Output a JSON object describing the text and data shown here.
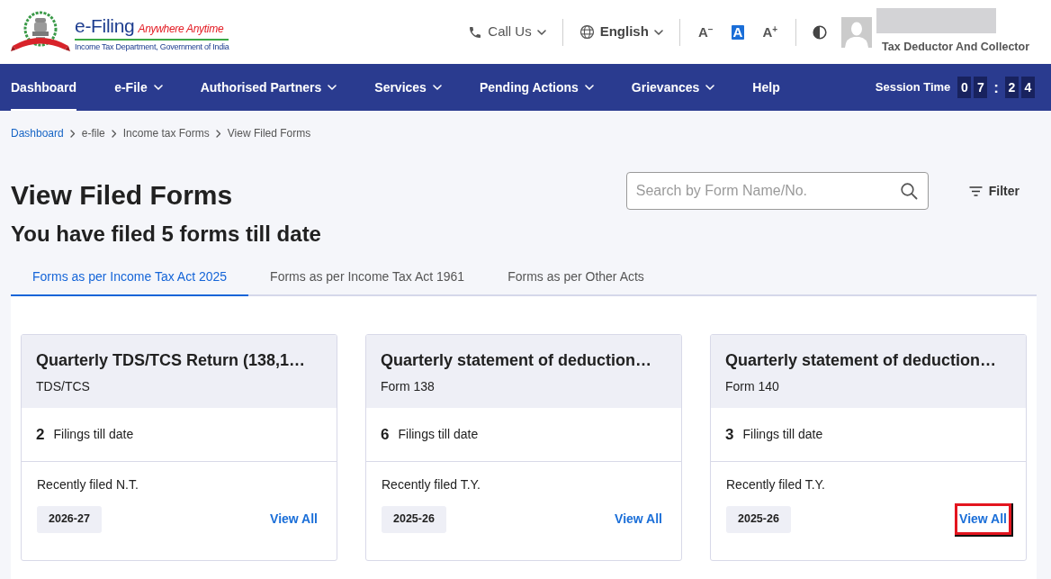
{
  "header": {
    "logo": {
      "brand": "e-Filing",
      "tagline": "Anywhere Anytime",
      "department": "Income Tax Department, Government of India"
    },
    "call_us": {
      "label": "Call Us"
    },
    "language": {
      "label": "English"
    },
    "text_size": [
      {
        "label": "A$^{−}$",
        "selected": false
      },
      {
        "label": "A",
        "selected": true
      },
      {
        "label": "A$^{+}$",
        "selected": false
      }
    ],
    "user": {
      "role": "Tax Deductor And Collector"
    }
  },
  "nav": {
    "items": [
      {
        "label": "Dashboard",
        "selected": true,
        "has_menu": false
      },
      {
        "label": "e-File",
        "selected": false,
        "has_menu": true
      },
      {
        "label": "Authorised Partners",
        "selected": false,
        "has_menu": true
      },
      {
        "label": "Services",
        "selected": false,
        "has_menu": true
      },
      {
        "label": "Pending Actions",
        "selected": false,
        "has_menu": true
      },
      {
        "label": "Grievances",
        "selected": false,
        "has_menu": true
      },
      {
        "label": "Help",
        "selected": false,
        "has_menu": false
      }
    ],
    "session_time": {
      "label": "Session Time",
      "segments": [
        {
          "kind": "digit",
          "text": "0"
        },
        {
          "kind": "digit",
          "text": "7"
        },
        {
          "kind": "separator",
          "text": ":"
        },
        {
          "kind": "digit",
          "text": "2"
        },
        {
          "kind": "digit",
          "text": "4"
        }
      ]
    }
  },
  "breadcrumbs": [
    {
      "label": "Dashboard",
      "link": true
    },
    {
      "label": "e-file",
      "link": false
    },
    {
      "label": "Income tax Forms",
      "link": false
    },
    {
      "label": "View Filed Forms",
      "link": false
    }
  ],
  "page": {
    "title": "View Filed Forms",
    "subtitle": "You have filed 5 forms till date"
  },
  "search": {
    "placeholder": "Search by Form Name/No."
  },
  "filter": {
    "label": "Filter"
  },
  "tabs": [
    {
      "label": "Forms as per Income Tax Act 2025",
      "selected": true
    },
    {
      "label": "Forms as per Income Tax Act 1961",
      "selected": false
    },
    {
      "label": "Forms as per Other Acts",
      "selected": false
    }
  ],
  "cards": [
    {
      "title": "Quarterly TDS/TCS Return (138,1…",
      "subtitle": "TDS/TCS",
      "count": "2",
      "count_label": "Filings till date",
      "recent_label": "Recently filed N.T.",
      "year": "2026-27",
      "view_all": {
        "label": "View All",
        "focused": false
      }
    },
    {
      "title": "Quarterly statement of deduction…",
      "subtitle": "Form 138",
      "count": "6",
      "count_label": "Filings till date",
      "recent_label": "Recently filed T.Y.",
      "year": "2025-26",
      "view_all": {
        "label": "View All",
        "focused": false
      }
    },
    {
      "title": "Quarterly statement of deduction…",
      "subtitle": "Form 140",
      "count": "3",
      "count_label": "Filings till date",
      "recent_label": "Recently filed T.Y.",
      "year": "2025-26",
      "view_all": {
        "label": "View All",
        "focused": true
      }
    }
  ]
}
